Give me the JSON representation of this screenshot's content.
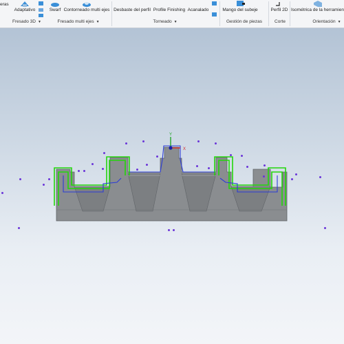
{
  "ribbon": {
    "partial_label_left": "eras",
    "buttons": {
      "adaptativo": "Adaptativo",
      "swarf": "Swarf",
      "contorneado": "Contorneado multi ejes",
      "desbaste": "Desbaste del perfil",
      "profile_finishing": "Profile Finishing",
      "acanalado": "Acanalado",
      "mango": "Mango del subeje",
      "perfil2d": "Perfil 2D",
      "isometrica": "Isométrica de la herramient"
    },
    "groups": {
      "fresado3d": "Fresado 3D",
      "fresado_multi": "Fresado multi ejes",
      "torneado": "Torneado",
      "gestion": "Gestión de piezas",
      "corte": "Corte",
      "orientacion": "Orientación"
    }
  },
  "viewport": {
    "triad_x": "X",
    "triad_y": "Y",
    "colors": {
      "part": "#8a8d90",
      "toolpath_green": "#22d60a",
      "toolpath_blue": "#2b3bd6",
      "points": "#6a35d8"
    }
  }
}
